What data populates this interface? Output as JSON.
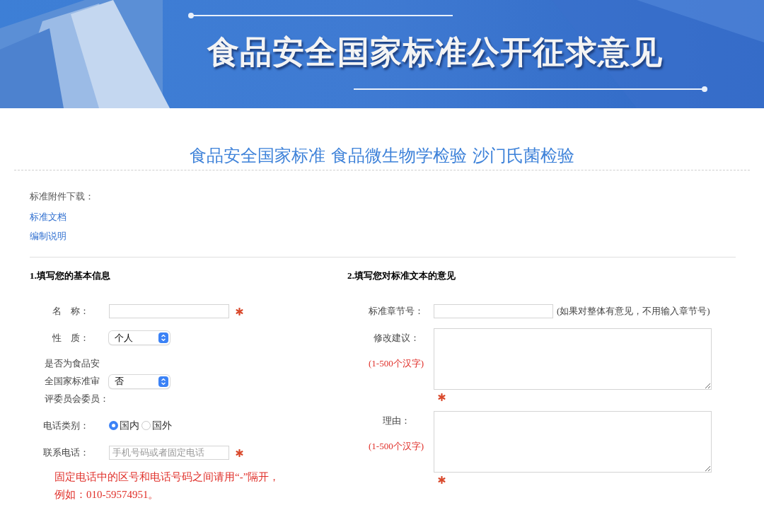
{
  "banner": {
    "title": "食品安全国家标准公开征求意见"
  },
  "page_title": "食品安全国家标准 食品微生物学检验 沙门氏菌检验",
  "attachments": {
    "label": "标准附件下载：",
    "links": [
      "标准文档",
      "编制说明"
    ]
  },
  "basic_info": {
    "heading": "1.填写您的基本信息",
    "fields": [
      {
        "kind": "text",
        "label_lines": [
          "名　称："
        ],
        "required": true
      },
      {
        "kind": "select",
        "label_lines": [
          "性　质："
        ],
        "value": "个人"
      },
      {
        "kind": "select",
        "label_lines": [
          "是否为食品安",
          "全国家标准审",
          "评委员会委员："
        ],
        "value": "否"
      },
      {
        "kind": "radio",
        "label_lines": [
          "电话类别："
        ],
        "options": [
          {
            "label": "国内",
            "selected": true
          },
          {
            "label": "国外",
            "selected": false
          }
        ]
      },
      {
        "kind": "text",
        "label_lines": [
          "联系电话："
        ],
        "placeholder": "手机号码或者固定电话",
        "required": true
      }
    ],
    "note_lines": [
      "固定电话中的区号和电话号码之间请用“-”隔开，",
      "例如：010-59574951。"
    ]
  },
  "comments": {
    "heading": "2.填写您对标准文本的意见",
    "fields": [
      {
        "kind": "text",
        "label": "标准章节号：",
        "hint": "(如果对整体有意见，不用输入章节号)"
      },
      {
        "kind": "textarea",
        "label": "修改建议：",
        "limit": "(1-500个汉字)",
        "required": true
      },
      {
        "kind": "textarea",
        "label": "理由：",
        "limit": "(1-500个汉字)",
        "required": true
      }
    ]
  }
}
